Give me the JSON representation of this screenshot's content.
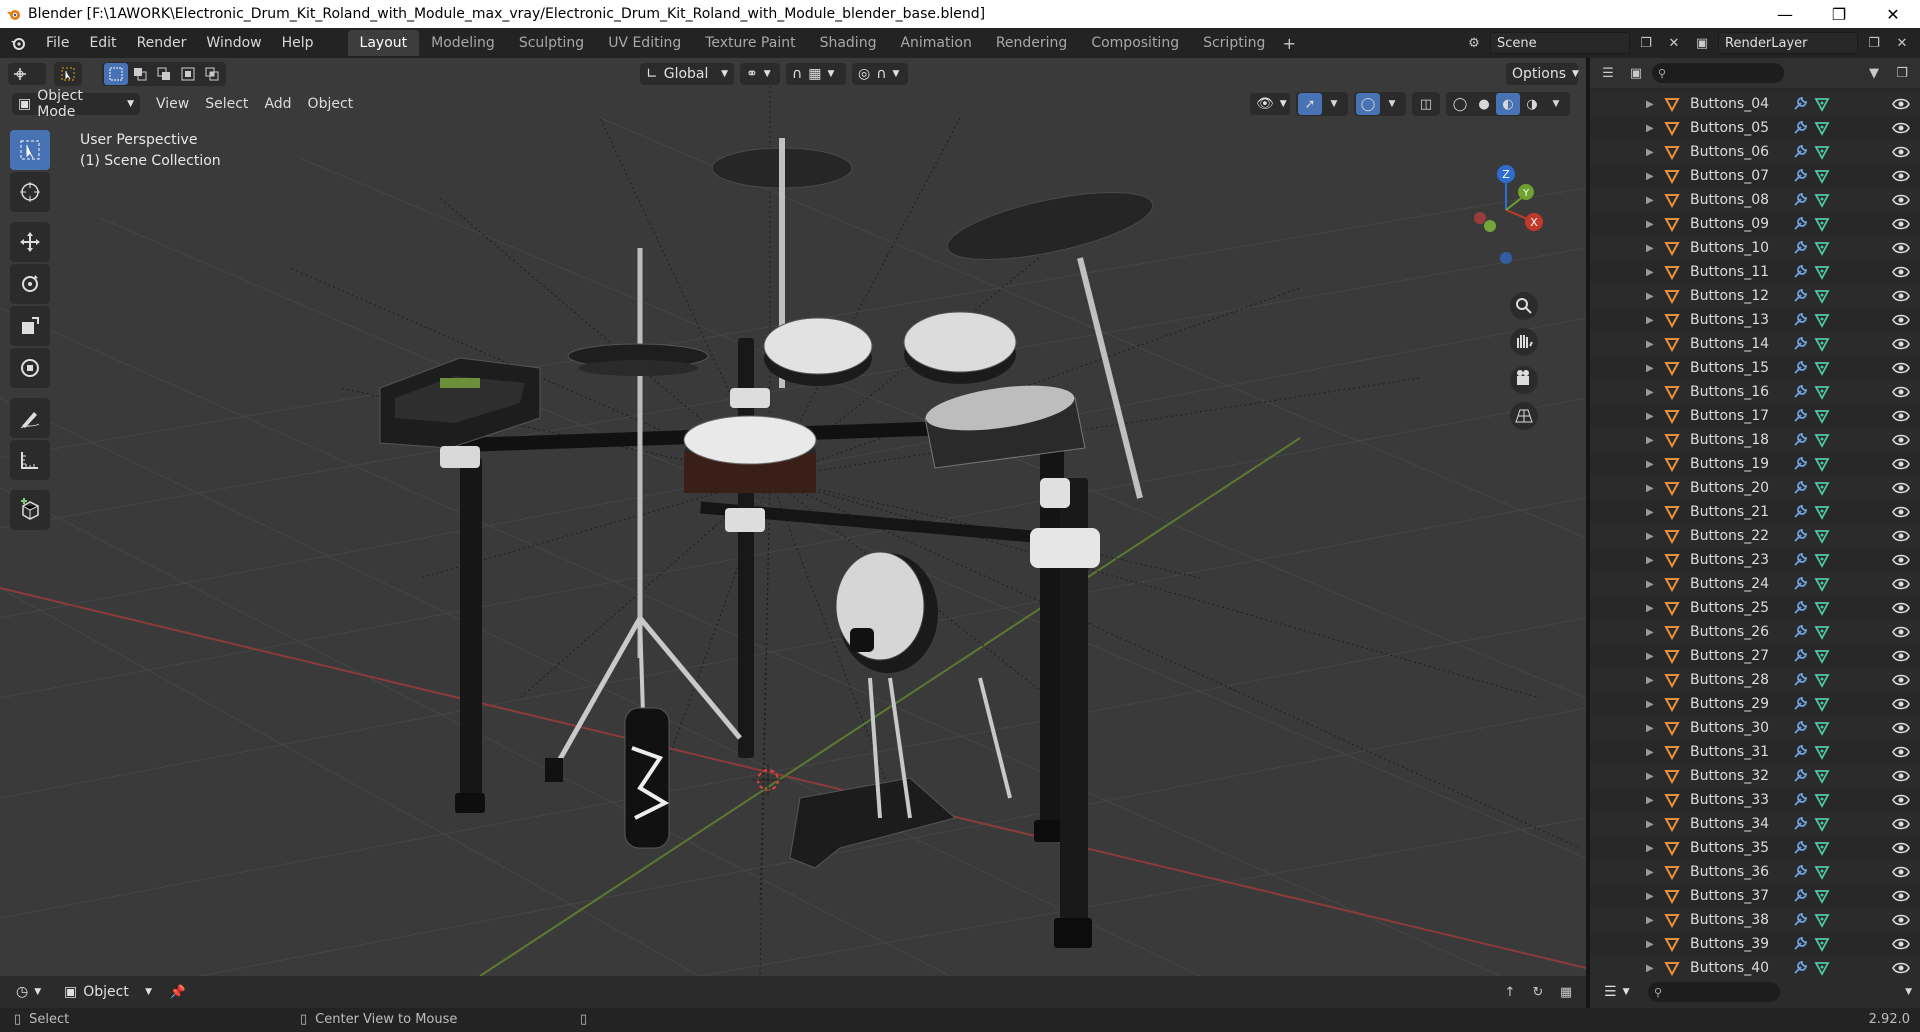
{
  "window": {
    "title": "Blender [F:\\1AWORK\\Electronic_Drum_Kit_Roland_with_Module_max_vray/Electronic_Drum_Kit_Roland_with_Module_blender_base.blend]",
    "controls": [
      "minimize-icon",
      "maximize-icon",
      "close-icon"
    ]
  },
  "menu": [
    "File",
    "Edit",
    "Render",
    "Window",
    "Help"
  ],
  "workspaces": [
    "Layout",
    "Modeling",
    "Sculpting",
    "UV Editing",
    "Texture Paint",
    "Shading",
    "Animation",
    "Rendering",
    "Compositing",
    "Scripting"
  ],
  "active_workspace": "Layout",
  "scene": {
    "name": "Scene",
    "render_layer": "RenderLayer"
  },
  "viewport": {
    "mode": "Object Mode",
    "menus": [
      "View",
      "Select",
      "Add",
      "Object"
    ],
    "transform_orientation": "Global",
    "options_label": "Options",
    "perspective_label": "User Perspective",
    "collection_label": "(1) Scene Collection"
  },
  "gizmo": {
    "x": "X",
    "y": "Y",
    "z": "Z"
  },
  "outliner": {
    "items": [
      "Buttons_04",
      "Buttons_05",
      "Buttons_06",
      "Buttons_07",
      "Buttons_08",
      "Buttons_09",
      "Buttons_10",
      "Buttons_11",
      "Buttons_12",
      "Buttons_13",
      "Buttons_14",
      "Buttons_15",
      "Buttons_16",
      "Buttons_17",
      "Buttons_18",
      "Buttons_19",
      "Buttons_20",
      "Buttons_21",
      "Buttons_22",
      "Buttons_23",
      "Buttons_24",
      "Buttons_25",
      "Buttons_26",
      "Buttons_27",
      "Buttons_28",
      "Buttons_29",
      "Buttons_30",
      "Buttons_31",
      "Buttons_32",
      "Buttons_33",
      "Buttons_34",
      "Buttons_35",
      "Buttons_36",
      "Buttons_37",
      "Buttons_38",
      "Buttons_39",
      "Buttons_40"
    ]
  },
  "timeline": {
    "mode": "Object"
  },
  "status": {
    "left": "Select",
    "middle": "Center View to Mouse",
    "version": "2.92.0"
  },
  "colors": {
    "accent": "#4772b3",
    "axis_x": "#c0392b",
    "axis_y": "#6ea12e",
    "axis_z": "#2f6cd0"
  }
}
